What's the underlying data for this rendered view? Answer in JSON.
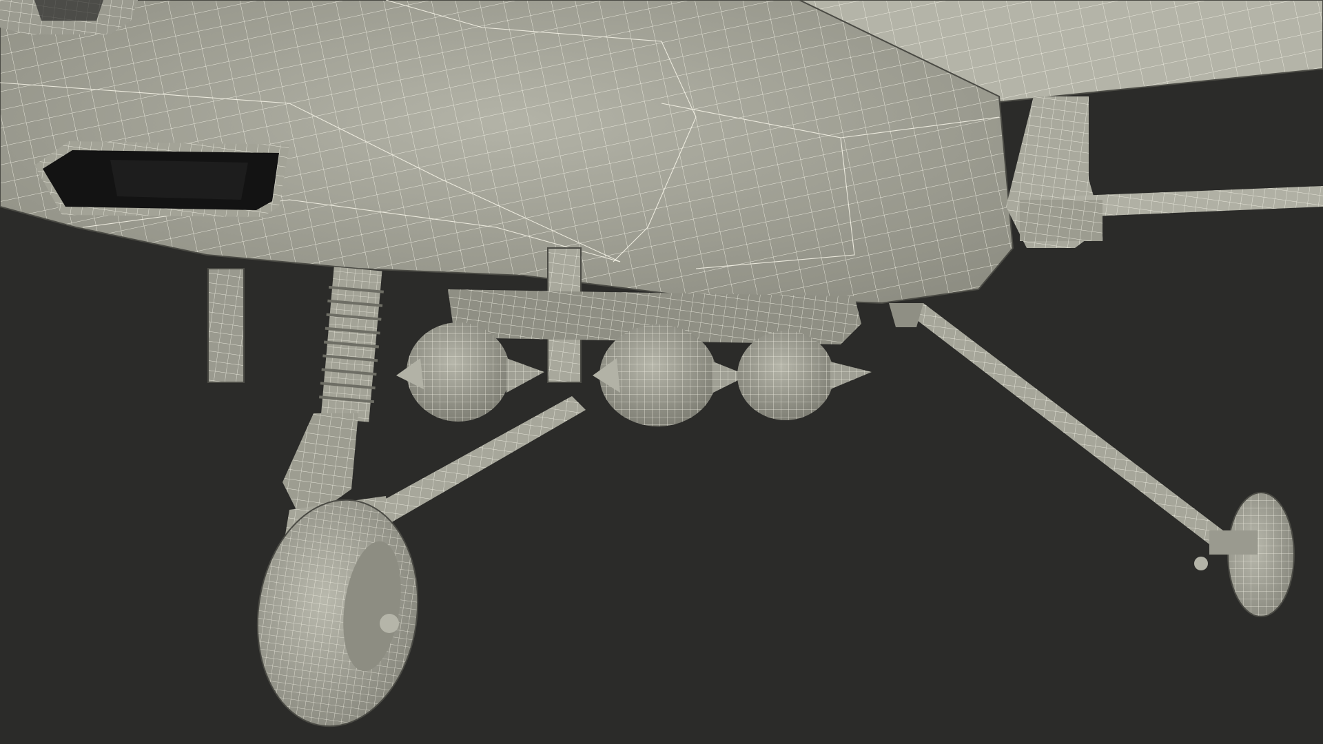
{
  "scene": {
    "subject": "wireframe-render",
    "colors": {
      "background": "#2b2b29",
      "surface": "#a9a99d",
      "surface_shadow": "#8c8c81",
      "surface_dark": "#6f6f66",
      "wireframe": "#f4f2e6",
      "cavity": "#111111"
    }
  }
}
